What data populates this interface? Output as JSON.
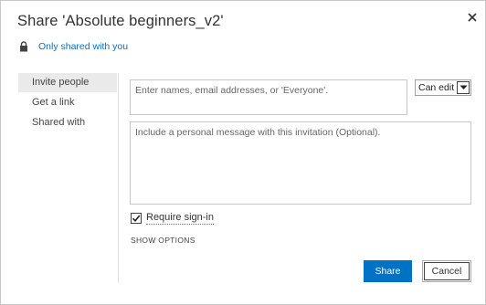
{
  "dialog": {
    "title": "Share 'Absolute beginners_v2'",
    "close_icon": "close-icon"
  },
  "sharing_status": {
    "icon": "lock-icon",
    "label": "Only shared with you"
  },
  "nav": {
    "items": [
      {
        "label": "Invite people",
        "active": true
      },
      {
        "label": "Get a link",
        "active": false
      },
      {
        "label": "Shared with",
        "active": false
      }
    ]
  },
  "invite": {
    "names_placeholder": "Enter names, email addresses, or 'Everyone'.",
    "permission": {
      "selected": "Can edit"
    },
    "message_placeholder": "Include a personal message with this invitation (Optional).",
    "require_signin": {
      "label": "Require sign-in",
      "checked": true
    },
    "show_options": "SHOW OPTIONS"
  },
  "actions": {
    "share_label": "Share",
    "cancel_label": "Cancel"
  },
  "colors": {
    "accent": "#0072c6",
    "selected_nav_bg": "#eaeaea"
  }
}
